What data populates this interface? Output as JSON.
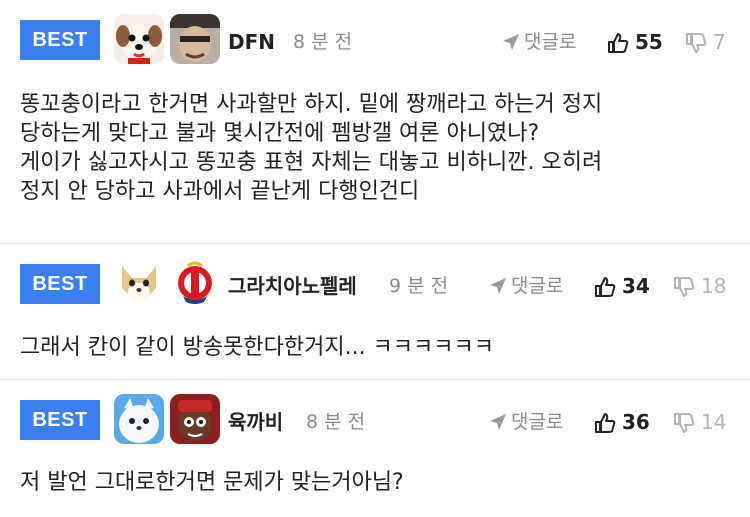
{
  "comments": [
    {
      "badge": "BEST",
      "nickname": "DFN",
      "time": "8 분 전",
      "reply_label": "댓글로",
      "likes": "55",
      "dislikes": "7",
      "lines": [
        "똥꼬충이라고 한거면 사과할만 하지. 밑에 짱깨라고 하는거 정지",
        "당하는게 맞다고 불과 몇시간전에 펨방갤 여론 아니였나?",
        "게이가 싫고자시고 똥꼬충 표현 자체는 대놓고 비하니깐. 오히려",
        "정지 안 당하고 사과에서 끝난게 다행인건디"
      ]
    },
    {
      "badge": "BEST",
      "nickname": "그라치아노펠레",
      "time": "9 분 전",
      "reply_label": "댓글로",
      "likes": "34",
      "dislikes": "18",
      "lines": [
        "그래서 칸이 같이 방송못한다한거지... ㅋㅋㅋㅋㅋㅋ"
      ]
    },
    {
      "badge": "BEST",
      "nickname": "육까비",
      "time": "8 분 전",
      "reply_label": "댓글로",
      "likes": "36",
      "dislikes": "14",
      "lines": [
        "저 발언 그대로한거면 문제가 맞는거아님?"
      ]
    }
  ],
  "icons": {
    "reply": "send-arrow-icon",
    "like": "thumbs-up-icon",
    "dislike": "thumbs-down-icon"
  },
  "colors": {
    "badge": "#3b7ff0",
    "muted": "#8a8a8a",
    "dislike": "#b3b3b3"
  }
}
